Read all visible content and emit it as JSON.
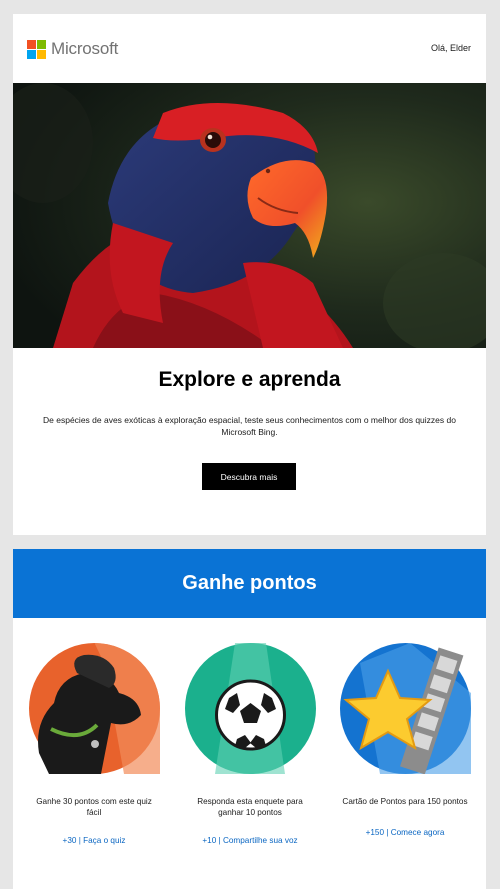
{
  "header": {
    "brand": "Microsoft",
    "greeting": "Olá, Elder",
    "logo_colors": [
      "#f25022",
      "#7fba00",
      "#00a4ef",
      "#ffb900"
    ]
  },
  "hero": {
    "image_icon": "parrot-photo"
  },
  "explore": {
    "title": "Explore e aprenda",
    "description": "De espécies de aves exóticas à exploração espacial, teste seus conhecimentos com o melhor dos quizzes do Microsoft Bing.",
    "cta_label": "Descubra mais"
  },
  "points": {
    "title": "Ganhe pontos",
    "accent": "#0a73d5",
    "items": [
      {
        "icon": "dog-icon",
        "text": "Ganhe 30 pontos com este quiz fácil",
        "link": "+30 | Faça o quiz"
      },
      {
        "icon": "soccer-ball-icon",
        "text": "Responda esta enquete para ganhar 10 pontos",
        "link": "+10 | Compartilhe sua voz"
      },
      {
        "icon": "star-film-icon",
        "text": "Cartão de Pontos para 150 pontos",
        "link": "+150 | Comece agora"
      }
    ]
  }
}
